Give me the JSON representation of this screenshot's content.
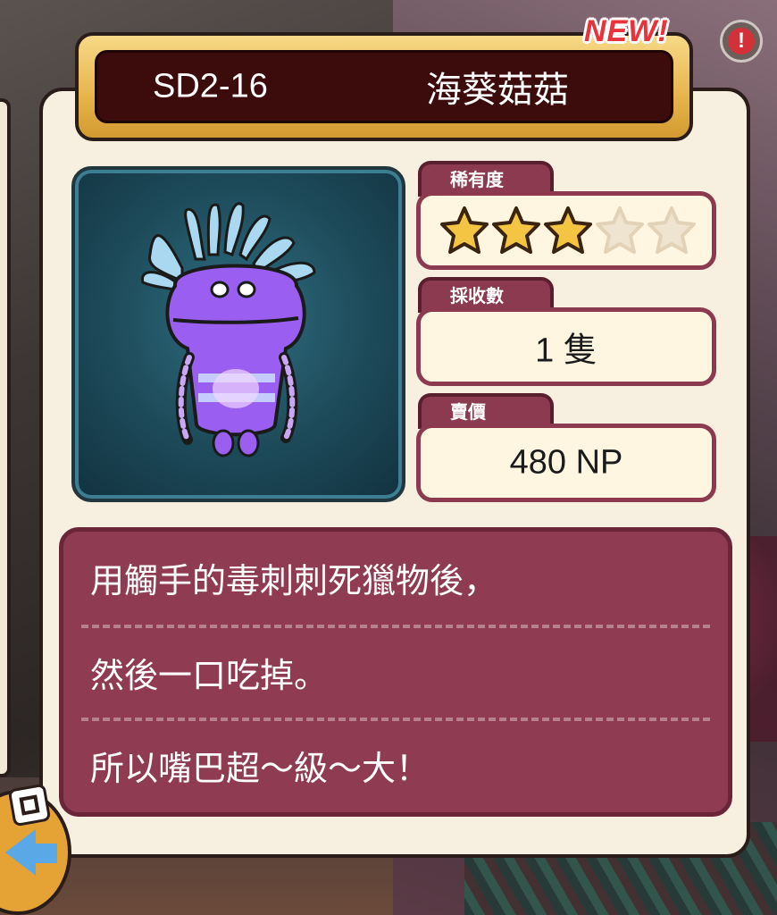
{
  "card": {
    "code": "SD2-16",
    "name": "海葵菇菇",
    "new_badge": "NEW!"
  },
  "stats": {
    "rarity": {
      "label": "稀有度",
      "filled": 3,
      "total": 5
    },
    "collected": {
      "label": "採收數",
      "value": "1 隻"
    },
    "price": {
      "label": "賣價",
      "value": "480 NP"
    }
  },
  "description": [
    "用觸手的毒刺刺死獵物後，",
    "然後一口吃掉。",
    "所以嘴巴超～級～大！"
  ],
  "icons": {
    "alert": "alert-icon",
    "back": "back-arrow-icon",
    "qr": "qr-code-icon"
  },
  "colors": {
    "banner_dark": "#3c0b0c",
    "gold": "#e6b44c",
    "maroon": "#8b3a4f",
    "star_filled": "#f4c542",
    "star_empty": "#efe4cf"
  }
}
